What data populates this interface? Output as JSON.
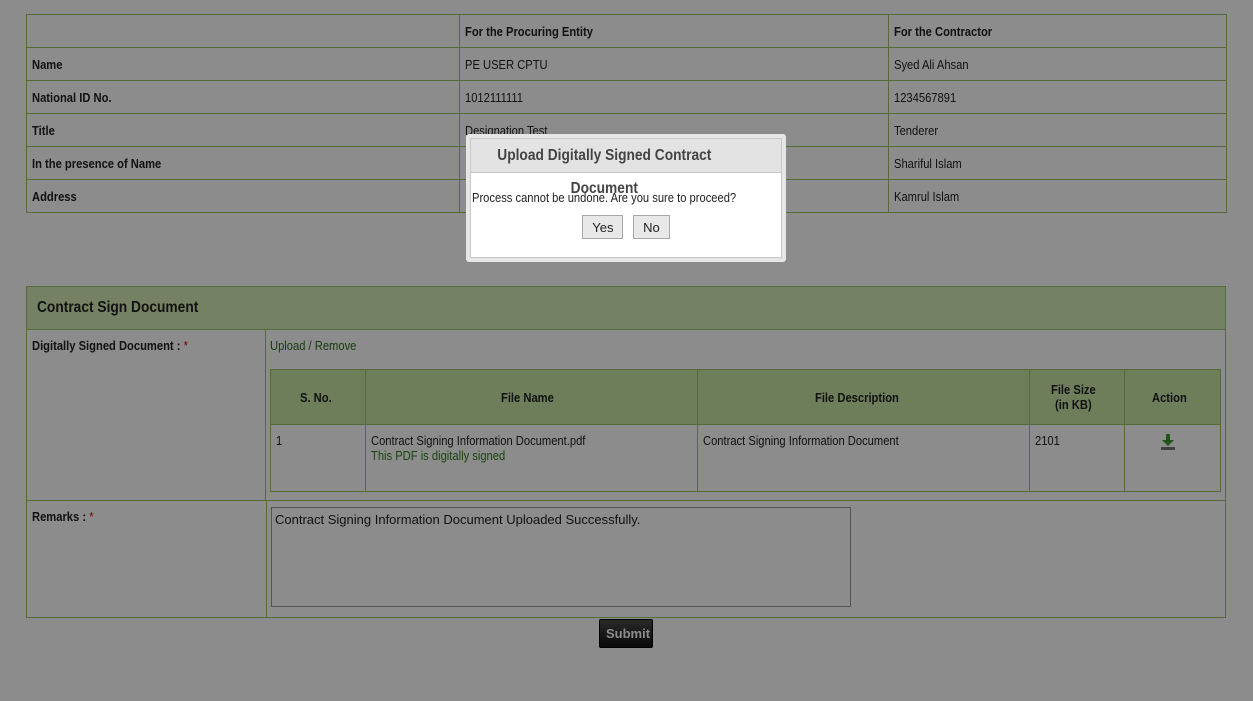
{
  "signatories": {
    "headers": [
      "",
      "For the Procuring Entity",
      "For the Contractor"
    ],
    "rows": [
      {
        "label": "Name",
        "pe": "PE USER CPTU",
        "contractor": "Syed Ali Ahsan"
      },
      {
        "label": "National ID No.",
        "pe": "1012111111",
        "contractor": "1234567891"
      },
      {
        "label": "Title",
        "pe": "Designation Test",
        "contractor": "Tenderer"
      },
      {
        "label": "In the presence of Name",
        "pe": "",
        "contractor": "Shariful Islam"
      },
      {
        "label": "Address",
        "pe": "",
        "contractor": "Kamrul Islam"
      }
    ]
  },
  "contract_sign": {
    "title": "Contract Sign Document",
    "doc_label": "Digitally Signed Document :",
    "required_mark": "*",
    "upload_link": "Upload / Remove",
    "files_headers": {
      "sno": "S. No.",
      "file_name": "File Name",
      "file_desc": "File Description",
      "file_size_l1": "File Size",
      "file_size_l2": "(in KB)",
      "action": "Action"
    },
    "files": [
      {
        "sno": "1",
        "file_name": "Contract Signing Information Document.pdf",
        "signed_note": "This PDF is digitally signed",
        "description": "Contract Signing Information Document",
        "size": "2101"
      }
    ],
    "remarks_label": "Remarks :",
    "remarks_value": "Contract Signing Information Document Uploaded Successfully."
  },
  "submit_label": "Submit",
  "dialog": {
    "title": "Upload Digitally Signed Contract Document",
    "message": "Process cannot be undone. Are you sure to proceed?",
    "yes": "Yes",
    "no": "No"
  },
  "colors": {
    "border": "#9cc46a",
    "header_bg": "#d4ecb3",
    "link": "#2d6d1a",
    "required": "#cc0000"
  }
}
